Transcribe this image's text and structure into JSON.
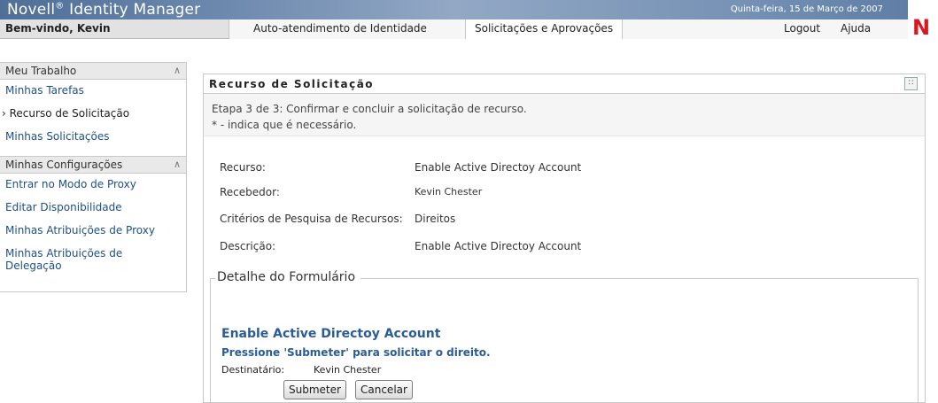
{
  "header": {
    "logo_prefix": "Novell",
    "logo_registered": "®",
    "logo_suffix": " Identity Manager",
    "date": "Quinta-feira, 15 de Março de 2007",
    "brand_mark": "N",
    "welcome": "Bem-vindo, Kevin"
  },
  "tabs": [
    {
      "label": "Auto-atendimento de Identidade"
    },
    {
      "label": "Solicitações e Aprovações"
    },
    {
      "label": "Logout"
    },
    {
      "label": "Ajuda"
    }
  ],
  "sidebar": {
    "section1": {
      "title": "Meu Trabalho",
      "items": [
        {
          "label": "Minhas Tarefas"
        },
        {
          "label": "Recurso de Solicitação"
        },
        {
          "label": "Minhas Solicitações"
        }
      ]
    },
    "section2": {
      "title": "Minhas Configurações",
      "items": [
        {
          "label": "Entrar no Modo de Proxy"
        },
        {
          "label": "Editar Disponibilidade"
        },
        {
          "label": "Minhas Atribuições de Proxy"
        },
        {
          "label": "Minhas Atribuições de Delegação"
        }
      ]
    }
  },
  "panel": {
    "title": "Recurso de Solicitação",
    "step": "Etapa 3 de 3: Confirmar e concluir a solicitação de recurso.",
    "required_note": "* - indica que é necessário.",
    "fields": [
      {
        "label": "Recurso:",
        "value": "Enable Active Directoy Account"
      },
      {
        "label": "Recebedor:",
        "value": "Kevin Chester"
      },
      {
        "label": "Critérios de Pesquisa de Recursos:",
        "value": "Direitos"
      },
      {
        "label": "Descrição:",
        "value": "Enable Active Directoy Account"
      }
    ],
    "form": {
      "legend": "Detalhe do Formulário",
      "title": "Enable Active Directoy Account",
      "subtitle": "Pressione 'Submeter' para solicitar o direito.",
      "recipient_label": "Destinatário:",
      "recipient_value": "Kevin Chester",
      "submit": "Submeter",
      "cancel": "Cancelar"
    }
  },
  "colors": {
    "brand_bar": "#6c88ad",
    "link": "#1e4f87",
    "form_title": "#2a5c99",
    "novell_red": "#d71921"
  }
}
